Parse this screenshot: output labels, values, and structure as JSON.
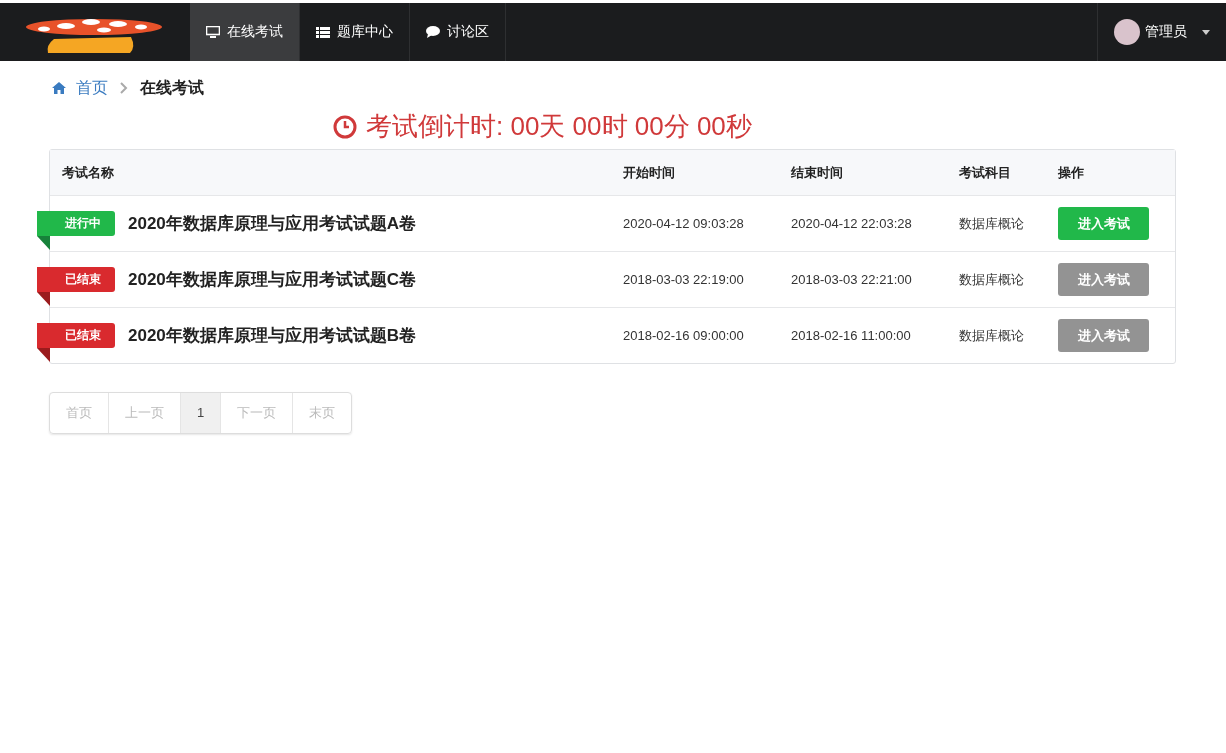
{
  "navbar": {
    "items": [
      {
        "label": "在线考试",
        "selected": true
      },
      {
        "label": "题库中心",
        "selected": false
      },
      {
        "label": "讨论区",
        "selected": false
      }
    ],
    "user": {
      "name": "管理员"
    }
  },
  "breadcrumb": [
    {
      "label": "首页",
      "kind": "link"
    },
    {
      "label": "在线考试",
      "kind": "current"
    }
  ],
  "countdown": "考试倒计时: 00天 00时 00分 00秒",
  "table": {
    "columns": [
      "考试名称",
      "开始时间",
      "结束时间",
      "考试科目",
      "操作"
    ],
    "rows": [
      {
        "status": "进行中",
        "kind": "running",
        "name": "2020年数据库原理与应用考试试题A卷",
        "start": "2020-04-12 09:03:28",
        "end": "2020-04-12 22:03:28",
        "subject": "数据库概论",
        "action": "进入考试",
        "disabled": false
      },
      {
        "status": "已结束",
        "kind": "ended",
        "name": "2020年数据库原理与应用考试试题C卷",
        "start": "2018-03-03 22:19:00",
        "end": "2018-03-03 22:21:00",
        "subject": "数据库概论",
        "action": "进入考试",
        "disabled": true
      },
      {
        "status": "已结束",
        "kind": "ended",
        "name": "2020年数据库原理与应用考试试题B卷",
        "start": "2018-02-16 09:00:00",
        "end": "2018-02-16 11:00:00",
        "subject": "数据库概论",
        "action": "进入考试",
        "disabled": true
      }
    ]
  },
  "pagination": [
    {
      "label": "首页",
      "selected": false,
      "disabled": true
    },
    {
      "label": "上一页",
      "selected": false,
      "disabled": true
    },
    {
      "label": "1",
      "selected": true,
      "disabled": false
    },
    {
      "label": "下一页",
      "selected": false,
      "disabled": true
    },
    {
      "label": "末页",
      "selected": false,
      "disabled": true
    }
  ]
}
